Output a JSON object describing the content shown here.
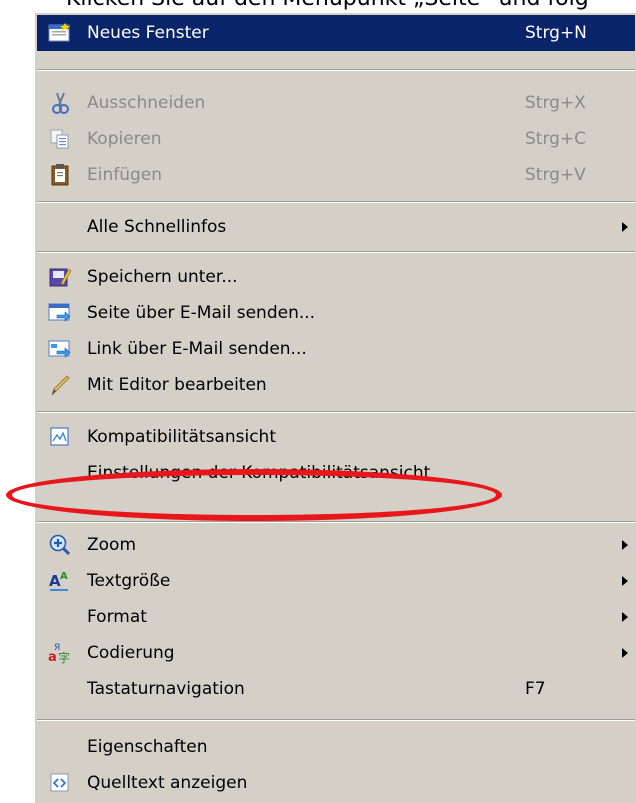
{
  "caption": "Klicken Sie auf den Menüpunkt „Seite“ und folg",
  "menu": {
    "items": [
      {
        "label": "Neues Fenster",
        "shortcut": "Strg+N",
        "icon": "new-window-icon",
        "highlighted": true
      },
      {
        "label": "Ausschneiden",
        "shortcut": "Strg+X",
        "icon": "scissors-icon",
        "disabled": true
      },
      {
        "label": "Kopieren",
        "shortcut": "Strg+C",
        "icon": "copy-icon",
        "disabled": true
      },
      {
        "label": "Einfügen",
        "shortcut": "Strg+V",
        "icon": "clipboard-icon",
        "disabled": true
      },
      {
        "label": "Alle Schnellinfos",
        "submenu": true
      },
      {
        "label": "Speichern unter...",
        "icon": "save-icon"
      },
      {
        "label": "Seite über E-Mail senden...",
        "icon": "mail-page-icon"
      },
      {
        "label": "Link über E-Mail senden...",
        "icon": "mail-link-icon"
      },
      {
        "label": "Mit Editor bearbeiten",
        "icon": "pencil-icon"
      },
      {
        "label": "Kompatibilitätsansicht",
        "icon": "compat-view-icon"
      },
      {
        "label": "Einstellungen der Kompatibilitätsansicht"
      },
      {
        "label": "Zoom",
        "icon": "zoom-icon",
        "submenu": true
      },
      {
        "label": "Textgröße",
        "icon": "text-size-icon",
        "submenu": true
      },
      {
        "label": "Format",
        "submenu": true
      },
      {
        "label": "Codierung",
        "icon": "encoding-icon",
        "submenu": true
      },
      {
        "label": "Tastaturnavigation",
        "shortcut": "F7"
      },
      {
        "label": "Eigenschaften"
      },
      {
        "label": "Quelltext anzeigen",
        "icon": "source-icon"
      }
    ]
  },
  "colors": {
    "menu_bg": "#d4d0c8",
    "highlight": "#0a246a",
    "annotation": "#e8171b"
  }
}
